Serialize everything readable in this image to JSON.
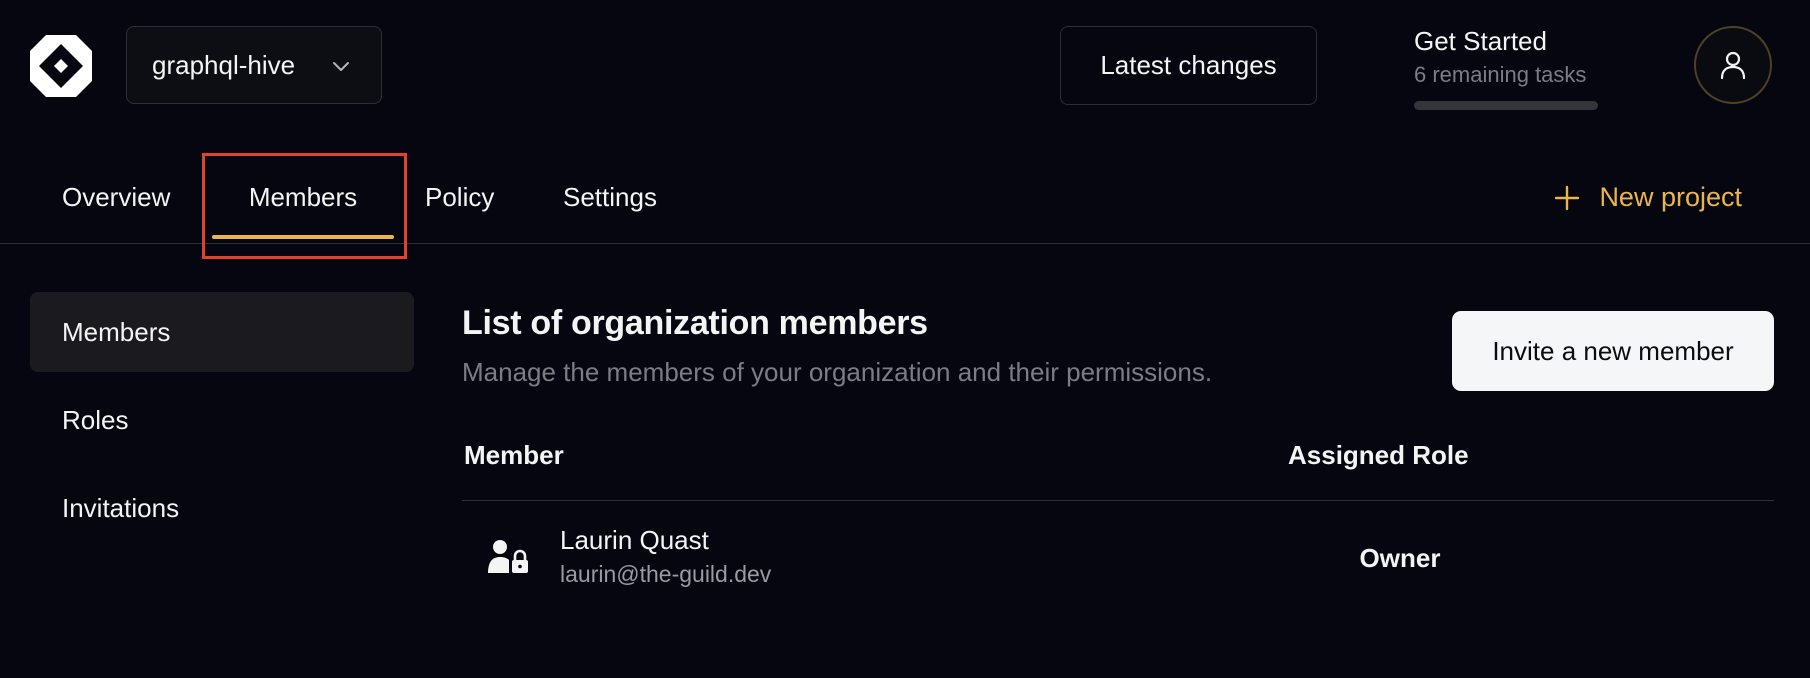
{
  "header": {
    "org_name": "graphql-hive",
    "latest_changes_label": "Latest changes",
    "get_started": {
      "title": "Get Started",
      "subtitle": "6 remaining tasks",
      "progress": 0
    }
  },
  "tabs": [
    {
      "label": "Overview",
      "active": false
    },
    {
      "label": "Members",
      "active": true
    },
    {
      "label": "Policy",
      "active": false
    },
    {
      "label": "Settings",
      "active": false
    }
  ],
  "new_project_label": "New project",
  "sidebar": {
    "items": [
      {
        "label": "Members",
        "active": true
      },
      {
        "label": "Roles",
        "active": false
      },
      {
        "label": "Invitations",
        "active": false
      }
    ]
  },
  "main": {
    "title": "List of organization members",
    "subtitle": "Manage the members of your organization and their permissions.",
    "invite_label": "Invite a new member",
    "table": {
      "columns": [
        "Member",
        "Assigned Role"
      ],
      "rows": [
        {
          "name": "Laurin Quast",
          "email": "laurin@the-guild.dev",
          "role": "Owner",
          "icon": "user-lock-icon"
        }
      ]
    }
  },
  "colors": {
    "background": "#05060f",
    "accent": "#eab54a",
    "highlight": "#e0432b",
    "muted_text": "#7c7c83",
    "border": "#2e2e33"
  },
  "icons": [
    "hive-logo-icon",
    "chevron-down-icon",
    "user-icon",
    "plus-icon",
    "user-lock-icon"
  ]
}
